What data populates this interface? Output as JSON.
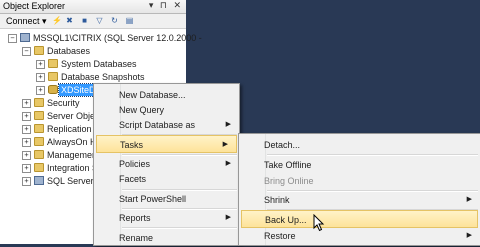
{
  "panel": {
    "title": "Object Explorer",
    "title_icons": "▾ ⊓ ✕",
    "connect_label": "Connect ▾"
  },
  "tree": {
    "server": "MSSQL1\\CITRIX (SQL Server 12.0.2000 -",
    "databases": "Databases",
    "system_databases": "System Databases",
    "database_snapshots": "Database Snapshots",
    "xdsite": "XDSiteDB",
    "security": "Security",
    "server_objects": "Server Object",
    "replication": "Replication",
    "alwayson": "AlwaysOn Hi",
    "management": "Managemen",
    "integration": "Integration S",
    "sql_agent": "SQL Server A"
  },
  "menu1": {
    "new_database": "New Database...",
    "new_query": "New Query",
    "script_database": "Script Database as",
    "tasks": "Tasks",
    "policies": "Policies",
    "facets": "Facets",
    "start_powershell": "Start PowerShell",
    "reports": "Reports",
    "rename": "Rename"
  },
  "menu2": {
    "detach": "Detach...",
    "take_offline": "Take Offline",
    "bring_online": "Bring Online",
    "shrink": "Shrink",
    "back_up": "Back Up...",
    "restore": "Restore"
  },
  "colors": {
    "background": "#293955",
    "selection": "#3399ff",
    "menu_highlight": "#fde39a"
  }
}
